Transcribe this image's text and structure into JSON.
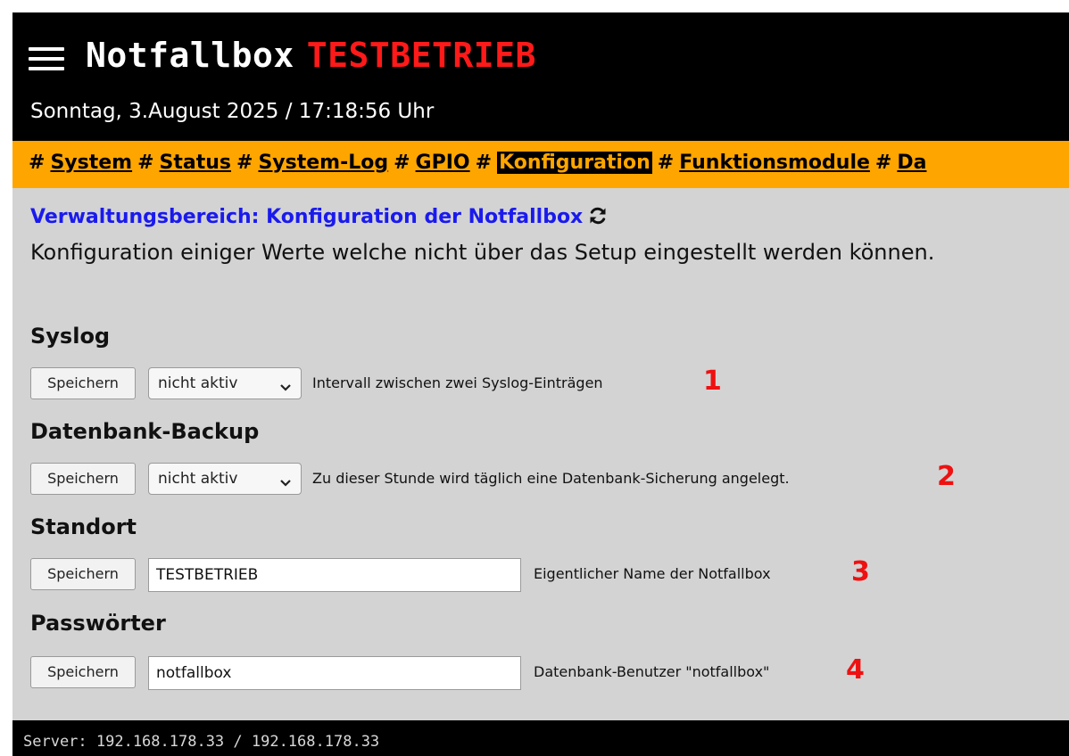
{
  "header": {
    "title": "Notfallbox",
    "mode": "TESTBETRIEB",
    "datetime": "Sonntag, 3.August 2025 / 17:18:56 Uhr"
  },
  "nav": {
    "separator": "#",
    "items": [
      {
        "label": "System"
      },
      {
        "label": "Status"
      },
      {
        "label": "System-Log"
      },
      {
        "label": "GPIO"
      },
      {
        "label": "Konfiguration",
        "active": true
      },
      {
        "label": "Funktionsmodule"
      },
      {
        "label": "Da"
      }
    ]
  },
  "page": {
    "heading": "Verwaltungsbereich: Konfiguration der Notfallbox",
    "description": "Konfiguration einiger Werte welche nicht über das Setup eingestellt werden können."
  },
  "sections": {
    "syslog": {
      "title": "Syslog",
      "button": "Speichern",
      "selected": "nicht aktiv",
      "hint": "Intervall zwischen zwei Syslog-Einträgen",
      "marker": "1"
    },
    "backup": {
      "title": "Datenbank-Backup",
      "button": "Speichern",
      "selected": "nicht aktiv",
      "hint": "Zu dieser Stunde wird täglich eine Datenbank-Sicherung angelegt.",
      "marker": "2"
    },
    "standort": {
      "title": "Standort",
      "button": "Speichern",
      "value": "TESTBETRIEB",
      "hint": "Eigentlicher Name der Notfallbox",
      "marker": "3"
    },
    "passwoerter": {
      "title": "Passwörter",
      "button": "Speichern",
      "value": "notfallbox",
      "hint": "Datenbank-Benutzer \"notfallbox\"",
      "marker": "4"
    }
  },
  "footer": {
    "server": "Server: 192.168.178.33 / 192.168.178.33"
  },
  "colors": {
    "header_bg": "#000000",
    "nav_bg": "#ffa500",
    "page_bg": "#d3d3d3",
    "mode_text": "#ff1a1a",
    "heading_text": "#1a1aee",
    "marker_text": "#ee1111"
  },
  "icons": {
    "menu": "hamburger-menu-icon",
    "refresh": "refresh-icon",
    "dropdown": "chevron-down-icon"
  }
}
